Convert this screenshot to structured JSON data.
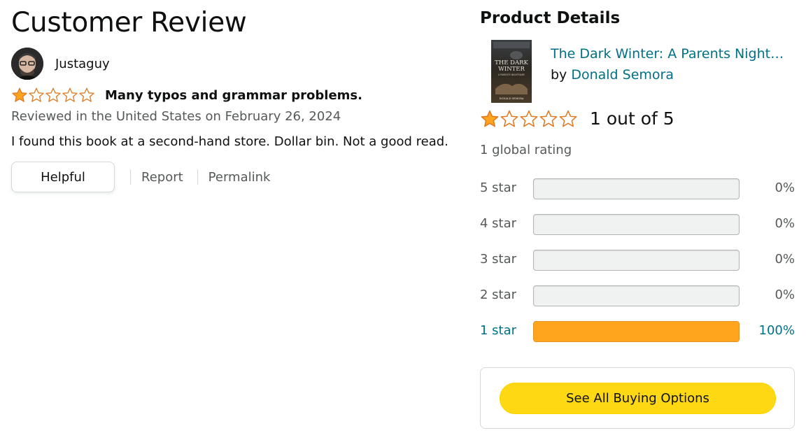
{
  "page": {
    "title": "Customer Review"
  },
  "review": {
    "reviewer_name": "Justaguy",
    "rating": 1,
    "max_rating": 5,
    "title": "Many typos and grammar problems.",
    "date_line": "Reviewed in the United States on February 26, 2024",
    "body": "I found this book at a second-hand store. Dollar bin. Not a good read.",
    "actions": {
      "helpful": "Helpful",
      "report": "Report",
      "permalink": "Permalink"
    }
  },
  "product": {
    "section_title": "Product Details",
    "title": "The Dark Winter: A Parents Nightmare",
    "by_label": "by",
    "author": "Donald Semora",
    "average_rating": 1,
    "average_text": "1 out of 5",
    "global_rating_text": "1 global rating",
    "cover_text": {
      "title": "THE DARK WINTER",
      "subtitle": "A PARENTS NIGHTMARE",
      "author": "DONALD SEMORA"
    }
  },
  "histogram": [
    {
      "label": "5 star",
      "percent": 0,
      "percent_text": "0%"
    },
    {
      "label": "4 star",
      "percent": 0,
      "percent_text": "0%"
    },
    {
      "label": "3 star",
      "percent": 0,
      "percent_text": "0%"
    },
    {
      "label": "2 star",
      "percent": 0,
      "percent_text": "0%"
    },
    {
      "label": "1 star",
      "percent": 100,
      "percent_text": "100%"
    }
  ],
  "buy_box": {
    "button_label": "See All Buying Options"
  },
  "colors": {
    "star": "#ffa41c",
    "link": "#007185",
    "buy_button": "#ffd814",
    "bar_empty": "#f0f2f2"
  }
}
